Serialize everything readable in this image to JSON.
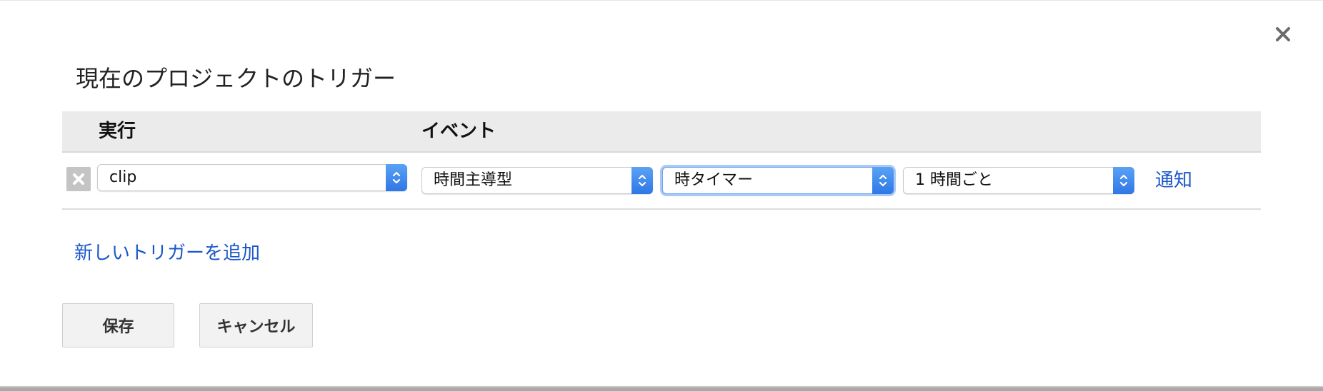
{
  "dialog": {
    "title": "現在のプロジェクトのトリガー",
    "close_icon": "close-icon"
  },
  "table": {
    "headers": {
      "run": "実行",
      "event": "イベント"
    },
    "rows": [
      {
        "function": "clip",
        "event_source": "時間主導型",
        "event_type": "時タイマー",
        "interval": "1 時間ごと",
        "notify": "通知"
      }
    ]
  },
  "add_trigger_link": "新しいトリガーを追加",
  "buttons": {
    "save": "保存",
    "cancel": "キャンセル"
  },
  "colors": {
    "link": "#1a56c9",
    "select_arrow": "#3b82ec",
    "header_bg": "#ebebeb"
  }
}
